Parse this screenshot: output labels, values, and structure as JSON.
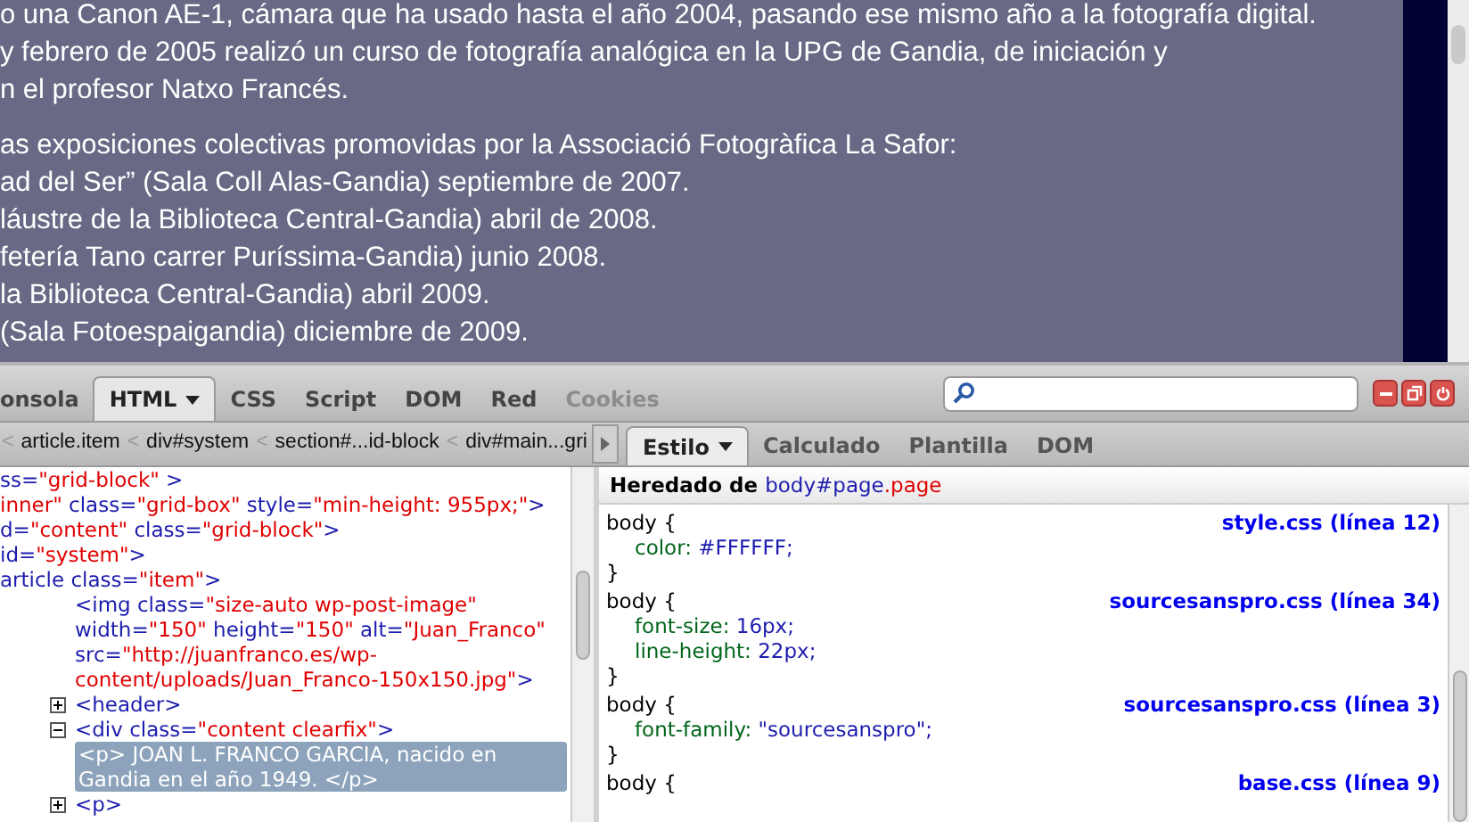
{
  "page": {
    "paragraphs": [
      [
        "o una Canon AE-1, cámara que ha usado hasta el año 2004, pasando ese mismo año a la fotografía digital.",
        "y febrero de 2005 realizó un curso de fotografía analógica en la UPG de Gandia, de iniciación y",
        "n el profesor Natxo Francés."
      ],
      [
        "as exposiciones colectivas promovidas por la Associació Fotogràfica La Safor:",
        "ad del Ser” (Sala Coll Alas-Gandia) septiembre de 2007.",
        "láustre de la Biblioteca Central-Gandia) abril de 2008.",
        "fetería Tano carrer Puríssima-Gandia) junio 2008.",
        "la Biblioteca Central-Gandia) abril 2009.",
        "(Sala Fotoespaigandia) diciembre de 2009."
      ]
    ]
  },
  "toolbar": {
    "tabs": [
      {
        "label": "onsola",
        "selected": false,
        "disabled": false,
        "menu": false
      },
      {
        "label": "HTML",
        "selected": true,
        "disabled": false,
        "menu": true
      },
      {
        "label": "CSS",
        "selected": false,
        "disabled": false,
        "menu": false
      },
      {
        "label": "Script",
        "selected": false,
        "disabled": false,
        "menu": false
      },
      {
        "label": "DOM",
        "selected": false,
        "disabled": false,
        "menu": false
      },
      {
        "label": "Red",
        "selected": false,
        "disabled": false,
        "menu": false
      },
      {
        "label": "Cookies",
        "selected": false,
        "disabled": true,
        "menu": false
      }
    ]
  },
  "breadcrumb": {
    "separator": "<",
    "items": [
      "article.item",
      "div#system",
      "section#...id-block",
      "div#main...gri"
    ]
  },
  "html_tree": {
    "nodes": [
      {
        "segments": [
          {
            "kind": "markup",
            "text": "ss="
          },
          {
            "kind": "value",
            "text": "\"grid-block\""
          },
          {
            "kind": "markup",
            "text": " >"
          }
        ]
      },
      {
        "segments": [
          {
            "kind": "value",
            "text": "inner\""
          },
          {
            "kind": "markup",
            "text": " class="
          },
          {
            "kind": "value",
            "text": "\"grid-box\""
          },
          {
            "kind": "markup",
            "text": " style="
          },
          {
            "kind": "value",
            "text": "\"min-height: 955px;\""
          },
          {
            "kind": "markup",
            "text": ">"
          }
        ]
      },
      {
        "segments": [
          {
            "kind": "markup",
            "text": "d="
          },
          {
            "kind": "value",
            "text": "\"content\""
          },
          {
            "kind": "markup",
            "text": " class="
          },
          {
            "kind": "value",
            "text": "\"grid-block\""
          },
          {
            "kind": "markup",
            "text": ">"
          }
        ]
      },
      {
        "segments": [
          {
            "kind": "markup",
            "text": "id="
          },
          {
            "kind": "value",
            "text": "\"system\""
          },
          {
            "kind": "markup",
            "text": ">"
          }
        ]
      },
      {
        "segments": [
          {
            "kind": "markup",
            "text": "article class="
          },
          {
            "kind": "value",
            "text": "\"item\""
          },
          {
            "kind": "markup",
            "text": ">"
          }
        ],
        "children": [
          {
            "segments": [
              {
                "kind": "markup",
                "text": "<img class="
              },
              {
                "kind": "value",
                "text": "\"size-auto wp-post-image\""
              },
              {
                "kind": "markup",
                "text": " width="
              },
              {
                "kind": "value",
                "text": "\"150\""
              },
              {
                "kind": "markup",
                "text": " height="
              },
              {
                "kind": "value",
                "text": "\"150\""
              },
              {
                "kind": "markup",
                "text": " alt="
              },
              {
                "kind": "value",
                "text": "\"Juan_Franco\""
              },
              {
                "kind": "markup",
                "text": " src="
              },
              {
                "kind": "value",
                "text": "\"http://juanfranco.es/wp-content/uploads/Juan_Franco-150x150.jpg\""
              },
              {
                "kind": "markup",
                "text": ">"
              }
            ]
          },
          {
            "segments": [
              {
                "kind": "markup",
                "text": "<header>"
              }
            ],
            "expanded": false
          },
          {
            "segments": [
              {
                "kind": "markup",
                "text": "<div class="
              },
              {
                "kind": "value",
                "text": "\"content clearfix\""
              },
              {
                "kind": "markup",
                "text": ">"
              }
            ],
            "expanded": true,
            "children": [
              {
                "segments": [
                  {
                    "text": "<p> JOAN L. FRANCO GARCIA, nacido en Gandia en el año 1949. </p>"
                  }
                ],
                "selected": true
              },
              {
                "segments": [
                  {
                    "kind": "markup",
                    "text": "<p>"
                  }
                ],
                "expanded": false
              }
            ]
          }
        ]
      }
    ]
  },
  "side_tabs": [
    {
      "label": "Estilo",
      "selected": true,
      "menu": true
    },
    {
      "label": "Calculado",
      "selected": false,
      "menu": false
    },
    {
      "label": "Plantilla",
      "selected": false,
      "menu": false
    },
    {
      "label": "DOM",
      "selected": false,
      "menu": false
    }
  ],
  "inherited": {
    "label": "Heredado de",
    "element": "body",
    "id": "#page",
    "cls": ".page"
  },
  "rules": [
    {
      "selector": "body {",
      "source": "style.css (línea 12)",
      "props": [
        {
          "name": "color:",
          "value": "#FFFFFF;"
        }
      ],
      "close": "}"
    },
    {
      "selector": "body {",
      "source": "sourcesanspro.css (línea 34)",
      "props": [
        {
          "name": "font-size:",
          "value": "16px;"
        },
        {
          "name": "line-height:",
          "value": "22px;"
        }
      ],
      "close": "}"
    },
    {
      "selector": "body {",
      "source": "sourcesanspro.css (línea 3)",
      "props": [
        {
          "name": "font-family:",
          "value": "\"sourcesanspro\";"
        }
      ],
      "close": "}"
    },
    {
      "selector": "body {",
      "source": "base.css (línea 9)"
    }
  ]
}
